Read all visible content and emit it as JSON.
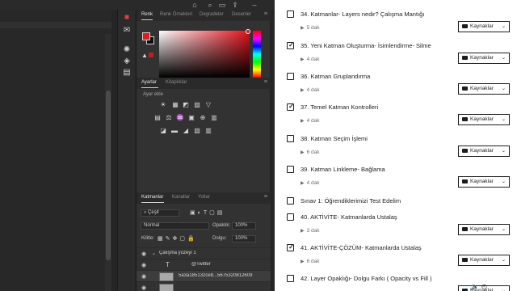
{
  "photoshop": {
    "top_icons": [
      "home-icon",
      "search-icon",
      "workspace-icon",
      "share-icon",
      "minimize-icon",
      "search-icon"
    ],
    "tool_icons": [
      "color-swatch-icon",
      "comment-icon",
      "adjustments-icon",
      "layers-icon",
      "channels-icon",
      "properties-icon"
    ],
    "color_panel": {
      "tabs": [
        "Renk",
        "Renk Örnekleri",
        "Degradeler",
        "Desenler"
      ],
      "active_tab": "Renk",
      "foreground_color": "#e31b1b",
      "background_color": "#0f0f0f"
    },
    "adjustments_panel": {
      "tabs": [
        "Ayarlar",
        "Kitaplıklar"
      ],
      "active_tab": "Ayarlar",
      "subtitle": "Ayar ekle",
      "rows": [
        [
          "☀",
          "▦",
          "◩",
          "▨",
          "▽"
        ],
        [
          "▤",
          "⚖",
          "♒",
          "▣",
          "⊕",
          "▥"
        ],
        [
          "◪",
          "▬",
          "◢",
          "▧",
          "▥"
        ]
      ]
    },
    "layers_panel": {
      "tabs": [
        "Katmanlar",
        "Kanallar",
        "Yollar"
      ],
      "active_tab": "Katmanlar",
      "filter_label": "Çeşit",
      "blend_mode": "Normal",
      "opacity_label": "Opaklık:",
      "opacity_value": "100%",
      "lock_label": "Kilitle:",
      "fill_label": "Dolgu:",
      "fill_value": "100%",
      "layers": [
        {
          "name": "Çalışma yüzeyi 1",
          "type": "group"
        },
        {
          "name": "@Twitter",
          "type": "text"
        },
        {
          "name": "5a3a185132ceb...5675320812609",
          "type": "image"
        },
        {
          "name": "",
          "type": "image"
        }
      ]
    }
  },
  "course": {
    "resources_label": "Kaynaklar",
    "items": [
      {
        "title": "34. Katmanlar- Layers nedir? Çalışma Mantığı",
        "duration": "5 dak",
        "checked": false,
        "resources": true
      },
      {
        "title": "35. Yeni Katman Oluşturma- İsimlendirme- Silme",
        "duration": "4 dak",
        "checked": true,
        "resources": true
      },
      {
        "title": "36. Katman Gruplandırma",
        "duration": "4 dak",
        "checked": false,
        "resources": true
      },
      {
        "title": "37. Temel Katman Kontrolleri",
        "duration": "4 dak",
        "checked": true,
        "resources": true
      },
      {
        "title": "38. Katman Seçim İşlemi",
        "duration": "6 dak",
        "checked": false,
        "resources": true
      },
      {
        "title": "39. Katman Linkleme- Bağlama",
        "duration": "4 dak",
        "checked": false,
        "resources": true
      },
      {
        "title": "Sınav 1: Öğrendiklerimizi Test Edelim",
        "duration": "",
        "checked": false,
        "resources": false
      },
      {
        "title": "40. AKTİVİTE- Katmanlarda Ustalaş",
        "duration": "3 dak",
        "checked": false,
        "resources": true
      },
      {
        "title": "41. AKTİVİTE-ÇÖZÜM- Katmanlarda Ustalaş",
        "duration": "6 dak",
        "checked": true,
        "resources": true
      },
      {
        "title": "42. Layer Opaklığı- Dolgu Farkı ( Opacity vs Fill )",
        "duration": "",
        "checked": false,
        "resources": true
      }
    ]
  }
}
